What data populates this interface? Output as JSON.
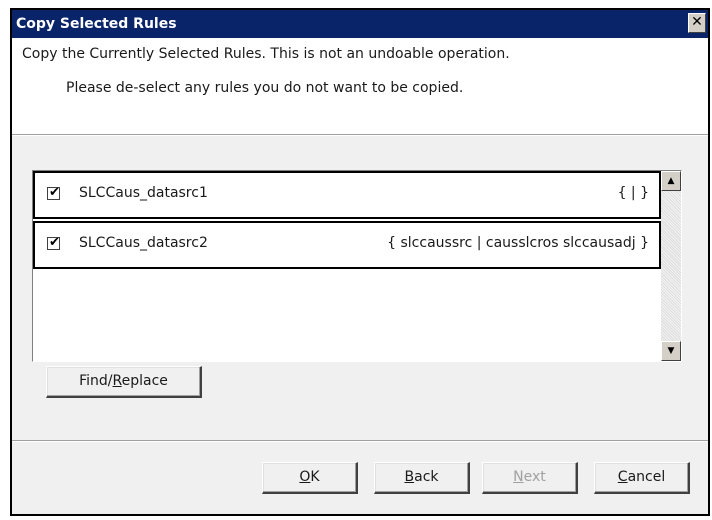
{
  "dialog": {
    "title": "Copy Selected Rules",
    "close_glyph": "✕"
  },
  "header": {
    "description": "Copy the Currently Selected Rules. This is not an undoable operation.",
    "instruction": "Please de-select any rules you do not want to be copied."
  },
  "rules": [
    {
      "checked": true,
      "name": "SLCCaus_datasrc1",
      "expression": "{ | }"
    },
    {
      "checked": true,
      "name": "SLCCaus_datasrc2",
      "expression": "{ slccaussrc | causslcros slccausadj }"
    }
  ],
  "buttons": {
    "find_replace": {
      "pre": "Find/",
      "mnemonic": "R",
      "post": "eplace"
    },
    "ok": {
      "pre": "",
      "mnemonic": "O",
      "post": "K"
    },
    "back": {
      "pre": "",
      "mnemonic": "B",
      "post": "ack"
    },
    "next": {
      "pre": "",
      "mnemonic": "N",
      "post": "ext",
      "disabled": true
    },
    "cancel": {
      "pre": "",
      "mnemonic": "C",
      "post": "ancel"
    }
  },
  "icons": {
    "checkbox_check": "✔",
    "scroll_up": "▲",
    "scroll_down": "▼"
  }
}
